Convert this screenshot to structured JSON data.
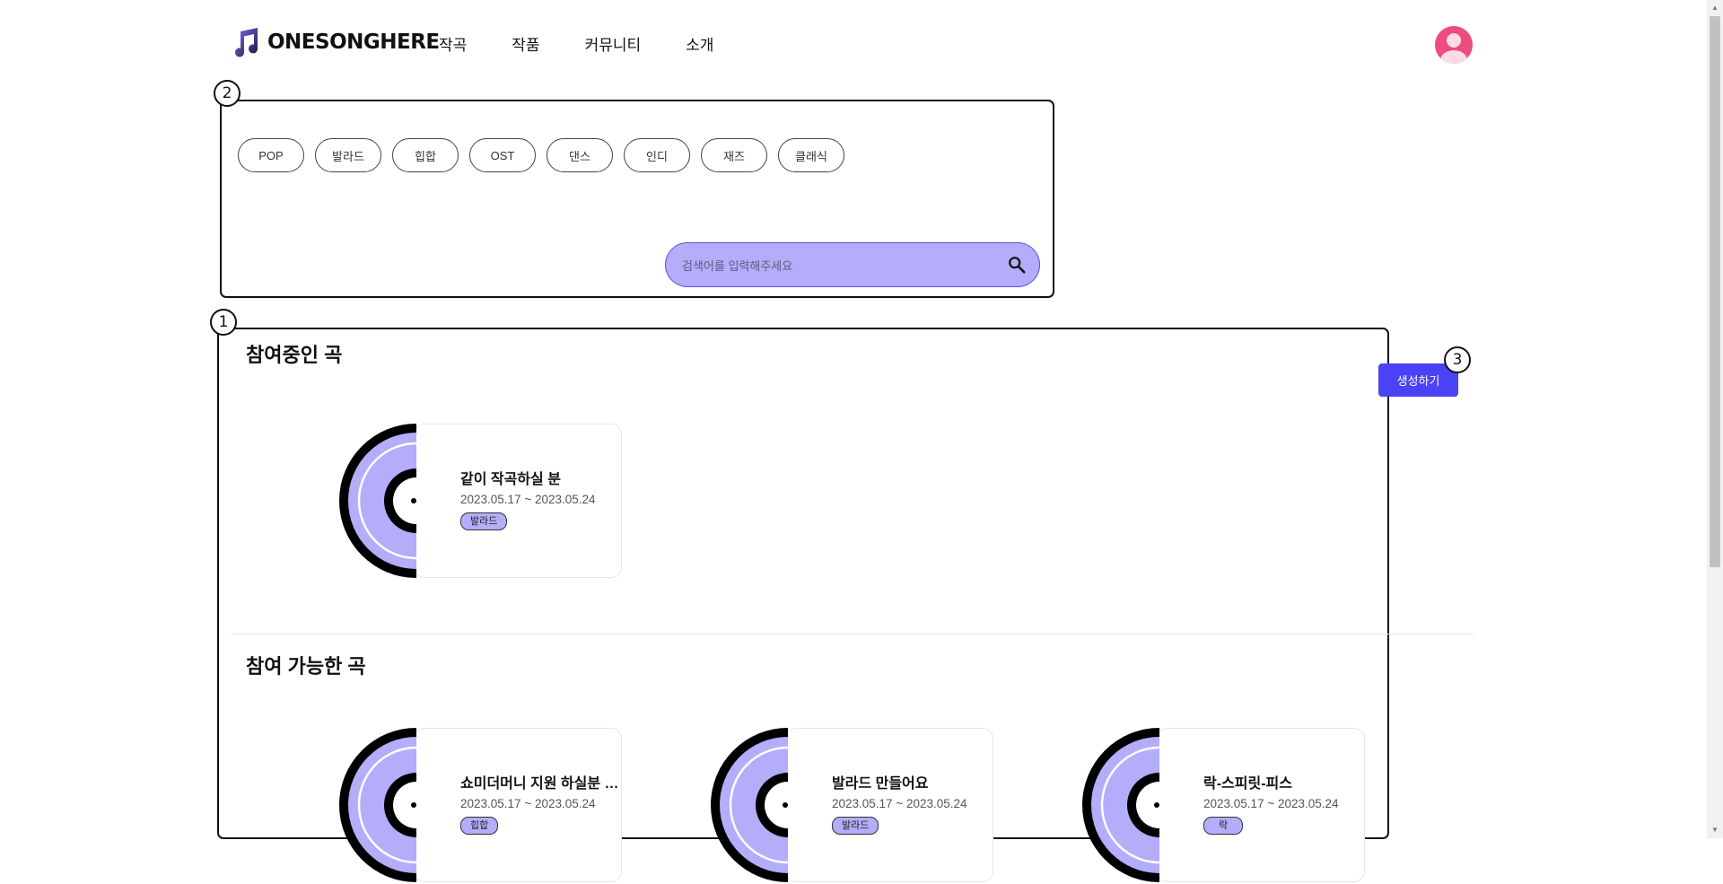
{
  "header": {
    "logo_text": "ONESONGHERE",
    "nav": [
      "작곡",
      "작품",
      "커뮤니티",
      "소개"
    ]
  },
  "annotations": [
    "2",
    "1",
    "3"
  ],
  "genres": [
    "POP",
    "발라드",
    "힙합",
    "OST",
    "댄스",
    "인디",
    "재즈",
    "클래식"
  ],
  "search": {
    "placeholder": "검색어를 입력해주세요",
    "value": ""
  },
  "create_button": "생성하기",
  "participating": {
    "title": "참여중인 곡",
    "songs": [
      {
        "title": "같이 작곡하실 분",
        "date": "2023.05.17 ~ 2023.05.24",
        "genre": "발라드"
      }
    ]
  },
  "available": {
    "title": "참여 가능한 곡",
    "songs": [
      {
        "title": "쇼미더머니 지원 하실분 구해요",
        "date": "2023.05.17 ~ 2023.05.24",
        "genre": "힙합"
      },
      {
        "title": "발라드 만들어요",
        "date": "2023.05.17 ~ 2023.05.24",
        "genre": "발라드"
      },
      {
        "title": "락-스피릿-피스",
        "date": "2023.05.17 ~ 2023.05.24",
        "genre": "락"
      }
    ]
  },
  "colors": {
    "accent": "#4a42f5",
    "accent_light": "#b3adfa",
    "avatar": "#ec4c7e"
  }
}
